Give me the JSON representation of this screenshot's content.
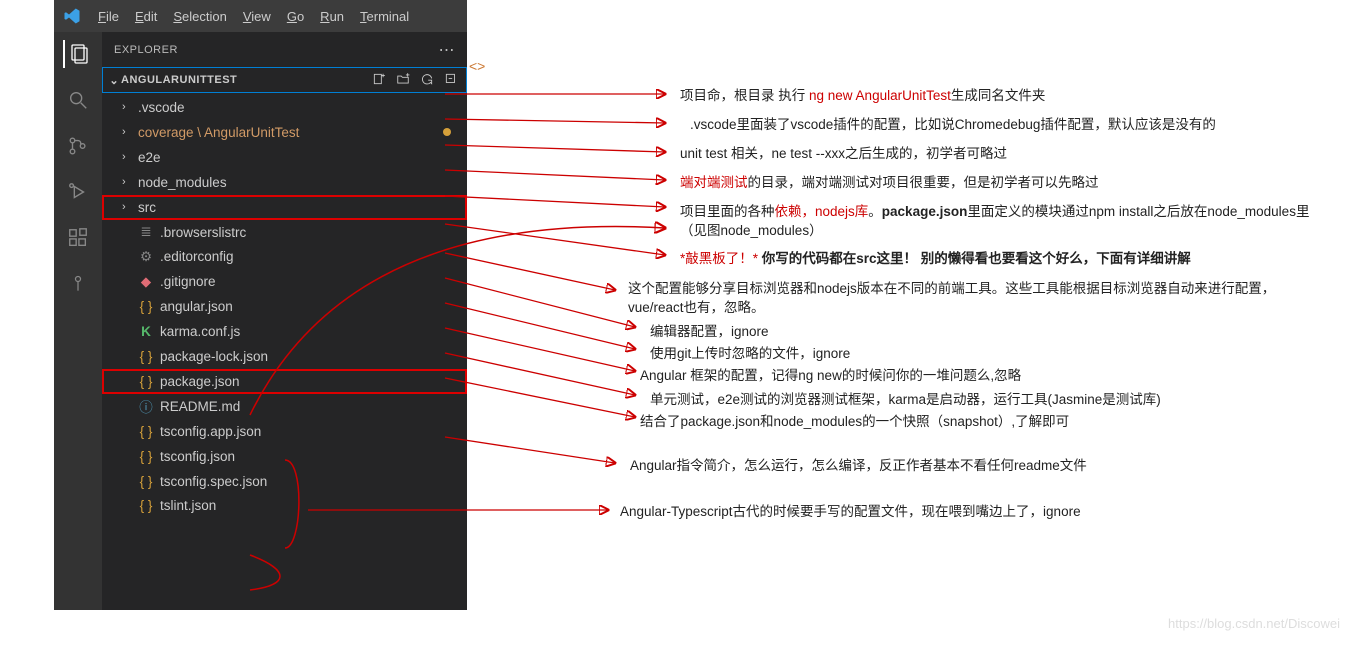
{
  "menu": {
    "items": [
      "File",
      "Edit",
      "Selection",
      "View",
      "Go",
      "Run",
      "Terminal"
    ]
  },
  "sidebar": {
    "title": "EXPLORER"
  },
  "project": {
    "name": "ANGULARUNITTEST"
  },
  "tree": {
    "items": [
      {
        "label": ".vscode",
        "folder": true
      },
      {
        "label": "coverage \\ AngularUnitTest",
        "folder": true,
        "orange": true,
        "dot": true
      },
      {
        "label": "e2e",
        "folder": true
      },
      {
        "label": "node_modules",
        "folder": true
      },
      {
        "label": "src",
        "folder": true,
        "highlight": true
      },
      {
        "label": ".browserslistrc",
        "icon": "list"
      },
      {
        "label": ".editorconfig",
        "icon": "gear"
      },
      {
        "label": ".gitignore",
        "icon": "git"
      },
      {
        "label": "angular.json",
        "icon": "json"
      },
      {
        "label": "karma.conf.js",
        "icon": "k"
      },
      {
        "label": "package-lock.json",
        "icon": "json"
      },
      {
        "label": "package.json",
        "icon": "json",
        "highlight": true
      },
      {
        "label": "README.md",
        "icon": "info"
      },
      {
        "label": "tsconfig.app.json",
        "icon": "json"
      },
      {
        "label": "tsconfig.json",
        "icon": "json"
      },
      {
        "label": "tsconfig.spec.json",
        "icon": "json"
      },
      {
        "label": "tslint.json",
        "icon": "json"
      }
    ]
  },
  "annos": [
    {
      "pre": "项目命，根目录 执行 ",
      "red": "ng new AngularUnitTest",
      "post": "生成同名文件夹"
    },
    {
      "pre": ".vscode里面装了vscode插件的配置，比如说Chromedebug插件配置，默认应该是没有的"
    },
    {
      "pre": "unit test 相关，ne test --xxx之后生成的，初学者可略过"
    },
    {
      "red": "端对端测试",
      "post": "的目录，端对端测试对项目很重要，但是初学者可以先略过"
    },
    {
      "pre": "项目里面的各种",
      "red": "依赖，nodejs库",
      "post": "。",
      "bold": "package.json",
      "post2": "里面定义的模块通过npm install之后放在node_modules里（见图node_modules）"
    },
    {
      "red": "*敲黑板了！* ",
      "bold": "你写的代码都在src这里！ 别的懒得看也要看这个好么，下面有详细讲解"
    },
    {
      "pre": "这个配置能够分享目标浏览器和nodejs版本在不同的前端工具。这些工具能根据目标浏览器自动来进行配置，vue/react也有，忽略。"
    },
    {
      "pre": "编辑器配置，ignore"
    },
    {
      "pre": "使用git上传时忽略的文件，ignore"
    },
    {
      "pre": "Angular 框架的配置，记得ng new的时候问你的一堆问题么,忽略"
    },
    {
      "pre": "单元测试，e2e测试的浏览器测试框架，karma是启动器，运行工具(Jasmine是测试库)"
    },
    {
      "pre": "结合了package.json和node_modules的一个快照（snapshot）,了解即可"
    },
    {
      "pre": "Angular指令简介，怎么运行，怎么编译，反正作者基本不看任何readme文件"
    },
    {
      "pre": "Angular-Typescript古代的时候要手写的配置文件，现在喂到嘴边上了，ignore"
    }
  ],
  "activity_icons": [
    "files-icon",
    "search-icon",
    "source-control-icon",
    "debug-icon",
    "extensions-icon",
    "save-point-icon"
  ],
  "watermark": "https://blog.csdn.net/Discowei"
}
